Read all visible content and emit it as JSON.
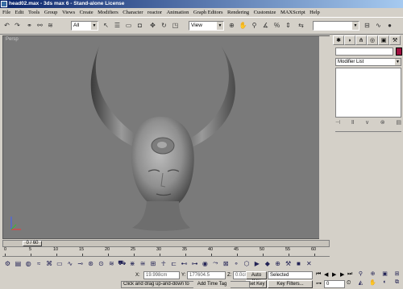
{
  "window": {
    "title": "head02.max - 3ds max 6 - Stand-alone License"
  },
  "menubar": [
    "File",
    "Edit",
    "Tools",
    "Group",
    "Views",
    "Create",
    "Modifiers",
    "Character",
    "reactor",
    "Animation",
    "Graph Editors",
    "Rendering",
    "Customize",
    "MAXScript",
    "Help"
  ],
  "toolbar": {
    "selection_filter": "All",
    "reference_coord": "View"
  },
  "viewport": {
    "label": "Persp"
  },
  "command_panel": {
    "object_color": "#a01040",
    "modifier_list": "Modifier List",
    "tabs": [
      "create-icon",
      "modify-icon",
      "hierarchy-icon",
      "motion-icon",
      "display-icon",
      "utilities-icon"
    ]
  },
  "timeline": {
    "current_frame": "0 / 60",
    "ticks": [
      "0",
      "5",
      "10",
      "15",
      "20",
      "25",
      "30",
      "35",
      "40",
      "45",
      "50",
      "55",
      "60"
    ]
  },
  "status": {
    "x_label": "X:",
    "x_value": "19.998cm",
    "y_label": "Y:",
    "y_value": "177604.5",
    "z_label": "Z:",
    "z_value": "0.0cm",
    "prompt": "Click and drag up-and-down to",
    "add_time_tag": "Add Time Tag",
    "auto_key": "Auto Key",
    "set_key": "Set Key",
    "key_mode": "Selected",
    "key_filters": "Key Filters...",
    "frame_field": "0"
  }
}
